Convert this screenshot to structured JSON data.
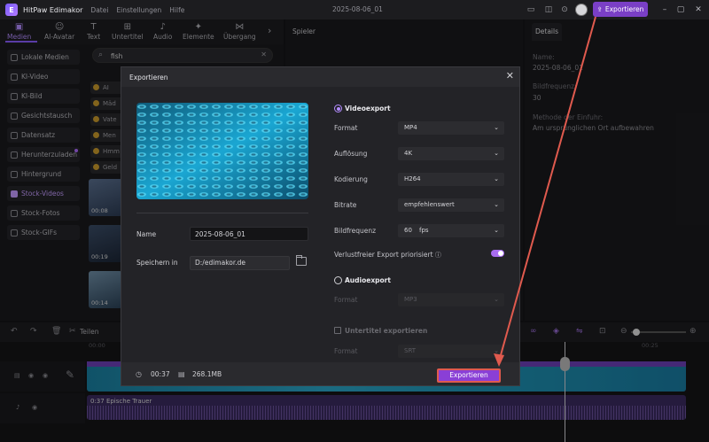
{
  "titlebar": {
    "app_title": "HitPaw Edimakor",
    "menu": [
      "Datei",
      "Einstellungen",
      "Hilfe"
    ],
    "doc_title": "2025-08-06_01",
    "export_label": "Exportieren"
  },
  "toolbar": {
    "tabs": [
      "Medien",
      "AI-Avatar",
      "Text",
      "Untertitel",
      "Audio",
      "Elemente",
      "Übergang"
    ]
  },
  "leftnav": {
    "items": [
      "Lokale Medien",
      "KI-Video",
      "KI-Bild",
      "Gesichtstausch",
      "Datensatz",
      "Herunterzuladen",
      "Hintergrund",
      "Stock-Videos",
      "Stock-Fotos",
      "Stock-GIFs"
    ]
  },
  "media": {
    "search_value": "fish",
    "chips": [
      "AI",
      "Mäd",
      "Vate",
      "Men",
      "Hmm",
      "Geld"
    ],
    "thumbs": [
      {
        "duration": "00:08"
      },
      {
        "duration": "00:19"
      },
      {
        "duration": "00:14"
      }
    ]
  },
  "player": {
    "title": "Spieler"
  },
  "details": {
    "tab": "Details",
    "name_label": "Name:",
    "name_value": "2025-08-06_01",
    "fps_label": "Bildfrequenz:",
    "fps_value": "30",
    "method_label": "Methode der Einfuhr:",
    "method_value": "Am ursprünglichen Ort aufbewahren"
  },
  "timeline": {
    "cut_label": "Teilen",
    "ruler": [
      "00:00",
      "00:25"
    ],
    "audio_name": "0:37 Epische Trauer"
  },
  "modal": {
    "title": "Exportieren",
    "name_label": "Name",
    "name_value": "2025-08-06_01",
    "save_label": "Speichern in",
    "save_path": "D:/edimakor.de",
    "video_export": "Videoexport",
    "format_label": "Format",
    "format_value": "MP4",
    "resolution_label": "Auflösung",
    "resolution_value": "4K",
    "encoding_label": "Kodierung",
    "encoding_value": "H264",
    "bitrate_label": "Bitrate",
    "bitrate_value": "empfehlenswert",
    "framerate_label": "Bildfrequenz",
    "framerate_value": "60",
    "framerate_unit": "fps",
    "lossless_label": "Verlustfreier Export priorisiert",
    "audio_export": "Audioexport",
    "audio_format_label": "Format",
    "audio_format_value": "MP3",
    "subtitle_export": "Untertitel exportieren",
    "subtitle_format_label": "Format",
    "subtitle_format_value": "SRT",
    "duration": "00:37",
    "size": "268.1MB",
    "export_button": "Exportieren"
  },
  "colors": {
    "accent": "#8a3fd6",
    "highlight": "#e05a4e"
  }
}
